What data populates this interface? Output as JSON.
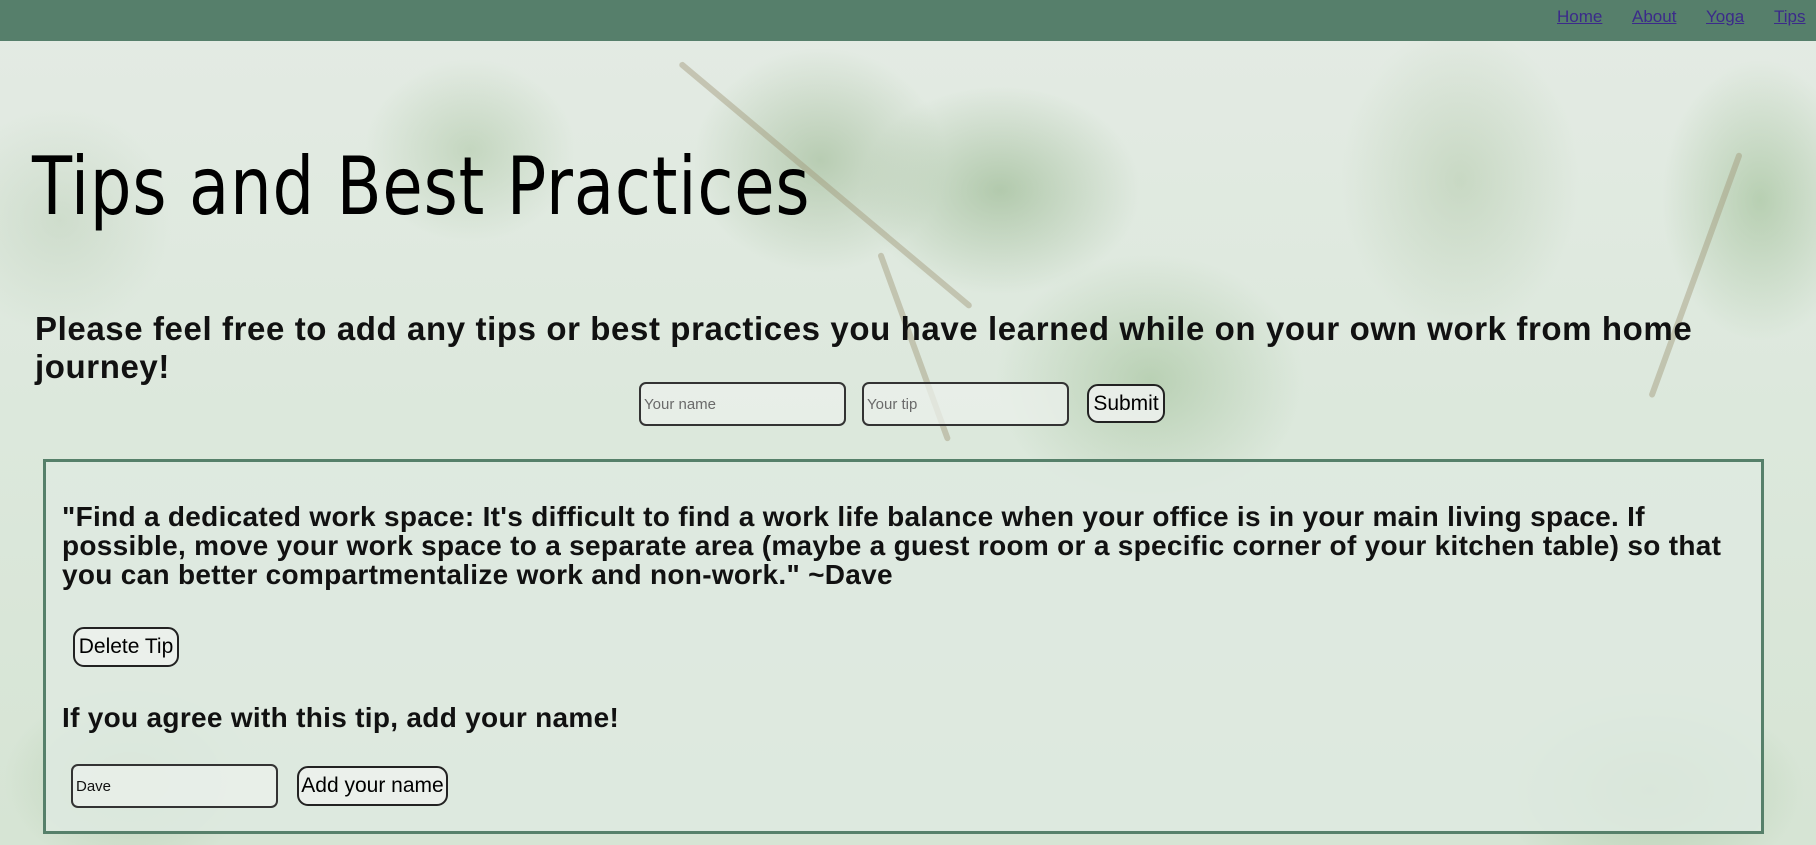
{
  "nav": {
    "items": [
      "Home",
      "About",
      "Yoga",
      "Tips"
    ]
  },
  "page": {
    "title": "Tips and Best Practices",
    "subtitle": "Please feel free to add any tips or best practices you have learned while on your own work from home journey!"
  },
  "form": {
    "name_placeholder": "Your name",
    "tip_placeholder": "Your tip",
    "submit_label": "Submit"
  },
  "tips": [
    {
      "text": "\"Find a dedicated work space: It's difficult to find a work life balance when your office is in your main living space. If possible, move your work space to a separate area (maybe a guest room or a specific corner of your kitchen table) so that you can better compartmentalize work and non-work.\" ~Dave",
      "delete_label": "Delete Tip",
      "agree_prompt": "If you agree with this tip, add your name!",
      "agree_name_value": "Dave",
      "add_name_label": "Add your name"
    }
  ],
  "colors": {
    "nav_bg": "#567f6b",
    "card_border": "#56806a",
    "link": "#3b2a8a"
  }
}
